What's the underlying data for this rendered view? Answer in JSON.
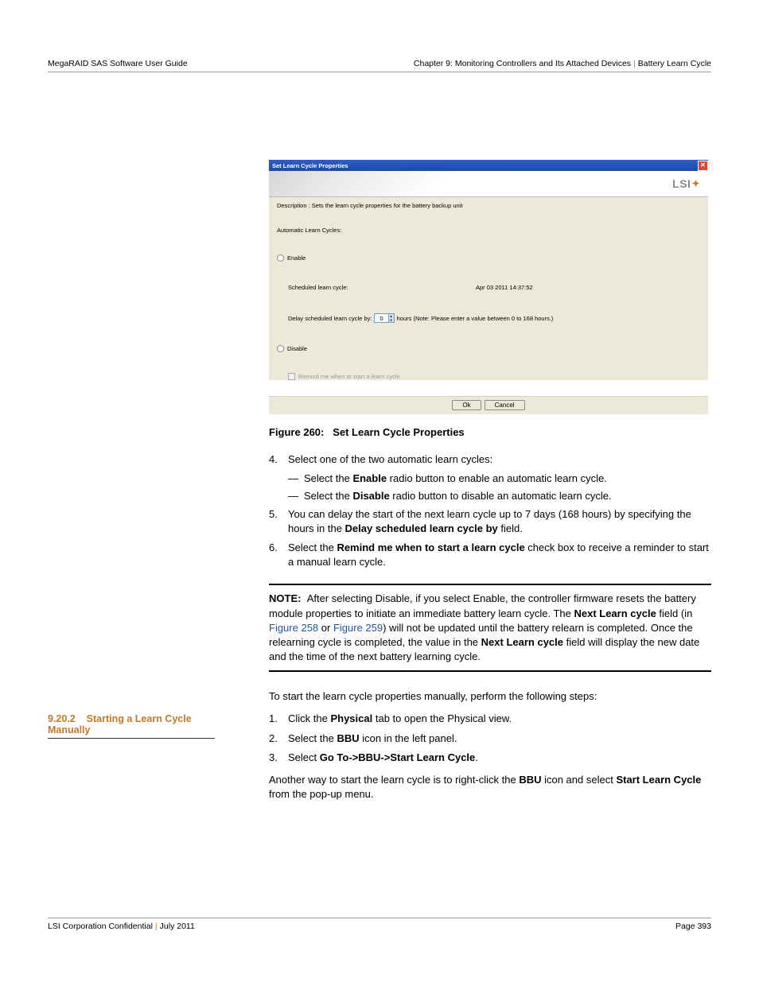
{
  "header": {
    "left": "MegaRAID SAS Software User Guide",
    "chapter": "Chapter 9: Monitoring Controllers and Its Attached Devices",
    "section": "Battery Learn Cycle"
  },
  "screenshot": {
    "title": "Set Learn Cycle Properties",
    "logo": "LSI",
    "description": "Description : Sets the learn cycle properties for the battery backup unit",
    "auto_label": "Automatic Learn Cycles:",
    "enable": "Enable",
    "sched_label": "Scheduled learn cycle:",
    "sched_value": "Apr 03 2011 14:37:52",
    "delay_label": "Delay scheduled learn cycle by:",
    "delay_value": "0",
    "delay_suffix": "hours (Note: Please enter a value between 0 to 168 hours.)",
    "disable": "Disable",
    "remind": "Remind me when to start a learn cycle",
    "ok": "Ok",
    "cancel": "Cancel"
  },
  "figure": {
    "number": "Figure 260:",
    "title": "Set Learn Cycle Properties"
  },
  "steps": {
    "s4": "Select one of the two automatic learn cycles:",
    "s4a_pre": "Select the ",
    "s4a_bold": "Enable",
    "s4a_post": " radio button to enable an automatic learn cycle.",
    "s4b_pre": "Select the ",
    "s4b_bold": "Disable",
    "s4b_post": " radio button to disable an automatic learn cycle.",
    "s5_pre": "You can delay the start of the next learn cycle up to 7 days (168 hours) by specifying the hours in the ",
    "s5_bold": "Delay scheduled learn cycle by",
    "s5_post": " field.",
    "s6_pre": "Select the ",
    "s6_bold": "Remind me when to start a learn cycle",
    "s6_post": " check box to receive a reminder to start a manual learn cycle."
  },
  "note": {
    "label": "NOTE:",
    "t1": "After selecting Disable, if you select Enable, the controller firmware resets the battery module properties to initiate an immediate battery learn cycle. The ",
    "b1": "Next Learn cycle",
    "t2": " field (in ",
    "l1": "Figure 258",
    "t3": " or ",
    "l2": "Figure 259",
    "t4": ") will not be updated until the battery relearn is completed. Once the relearning cycle is completed, the value in the ",
    "b2": "Next Learn cycle",
    "t5": " field will display the new date and the time of the next battery learning cycle."
  },
  "section2": {
    "number": "9.20.2",
    "title": "Starting a Learn Cycle Manually",
    "intro": "To start the learn cycle properties manually, perform the following steps:",
    "s1_pre": "Click the ",
    "s1_bold": "Physical",
    "s1_post": " tab to open the Physical view.",
    "s2_pre": "Select the ",
    "s2_bold": "BBU",
    "s2_post": " icon in the left panel.",
    "s3_pre": "Select ",
    "s3_bold": "Go To->BBU->Start Learn Cycle",
    "s3_post": ".",
    "alt_t1": "Another way to start the learn cycle is to right-click the ",
    "alt_b1": "BBU",
    "alt_t2": " icon and select ",
    "alt_b2": "Start Learn Cycle",
    "alt_t3": " from the pop-up menu."
  },
  "footer": {
    "left1": "LSI Corporation Confidential",
    "left2": "July 2011",
    "right": "Page 393"
  }
}
